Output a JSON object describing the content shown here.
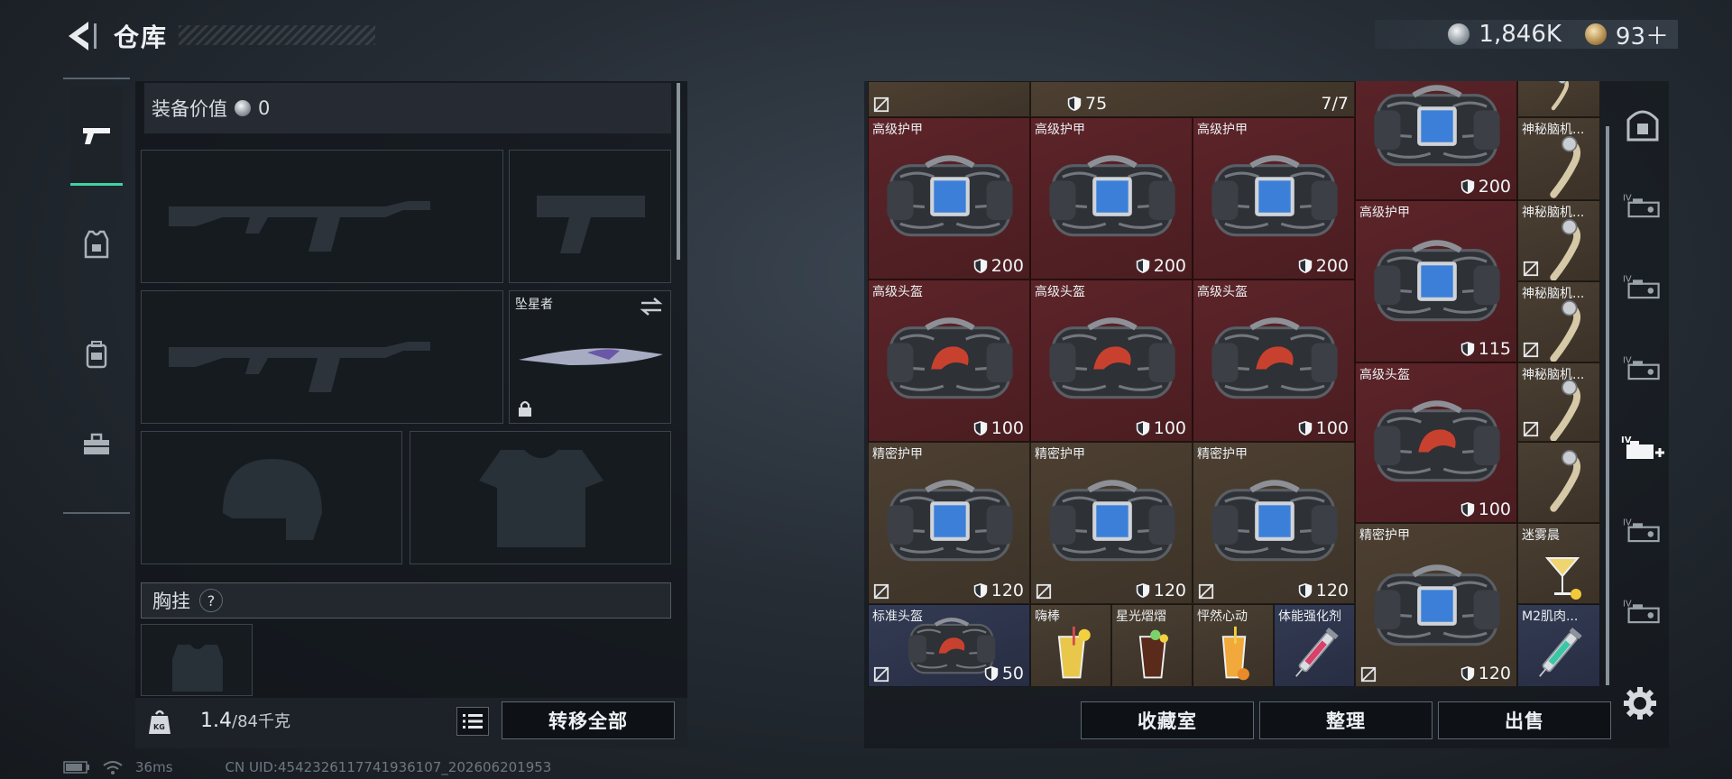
{
  "header": {
    "title": "仓库"
  },
  "currency": {
    "silver": "1,846K",
    "gold": "93＋"
  },
  "left_rail": {
    "items": [
      {
        "name": "weapons",
        "icon": "pistol-icon",
        "active": true
      },
      {
        "name": "armor",
        "icon": "armor-vest-icon",
        "active": false
      },
      {
        "name": "backpack",
        "icon": "backpack-icon",
        "active": false
      },
      {
        "name": "toolbox",
        "icon": "toolbox-icon",
        "active": false
      }
    ]
  },
  "equipment": {
    "value_label": "装备价值",
    "value": "0",
    "melee_name": "坠星者",
    "chest_rig_label": "胸挂",
    "help_mark": "?",
    "weight_current": "1.4",
    "weight_max": "/84千克",
    "transfer_all_label": "转移全部"
  },
  "storage": {
    "top_row": {
      "first_value": "75",
      "second_value": "7/7"
    },
    "cells": [
      {
        "name": "高级护甲",
        "value": "200"
      },
      {
        "name": "高级护甲",
        "value": "200"
      },
      {
        "name": "高级护甲",
        "value": "200"
      },
      {
        "name": "",
        "value": "200"
      },
      {
        "name": "神秘脑机...",
        "value": ""
      },
      {
        "name": "神秘脑机...",
        "value": ""
      },
      {
        "name": "高级护甲",
        "value": "115"
      },
      {
        "name": "高级头盔",
        "value": "100"
      },
      {
        "name": "高级头盔",
        "value": "100"
      },
      {
        "name": "高级头盔",
        "value": "100"
      },
      {
        "name": "神秘脑机...",
        "value": ""
      },
      {
        "name": "高级头盔",
        "value": "100"
      },
      {
        "name": "神秘脑机...",
        "value": ""
      },
      {
        "name": "精密护甲",
        "value": "120"
      },
      {
        "name": "精密护甲",
        "value": "120"
      },
      {
        "name": "精密护甲",
        "value": "120"
      },
      {
        "name": "迷雾晨",
        "value": ""
      },
      {
        "name": "精密护甲",
        "value": "120"
      },
      {
        "name": "标准头盔",
        "value": "50"
      },
      {
        "name": "嗨棒",
        "value": ""
      },
      {
        "name": "星光熠熠",
        "value": ""
      },
      {
        "name": "怦然心动",
        "value": ""
      },
      {
        "name": "体能强化剂",
        "value": ""
      },
      {
        "name": "M2肌肉...",
        "value": ""
      }
    ],
    "buttons": {
      "collection": "收藏室",
      "organize": "整理",
      "sell": "出售"
    }
  },
  "right_rail": {
    "items": [
      {
        "icon": "safe-box-icon"
      },
      {
        "icon": "case-iv-icon"
      },
      {
        "icon": "case-iv-icon"
      },
      {
        "icon": "case-iv-icon"
      },
      {
        "icon": "case-iv-add-icon"
      },
      {
        "icon": "case-iv-icon"
      },
      {
        "icon": "case-iv-icon"
      }
    ]
  },
  "status": {
    "ping": "36ms",
    "uid": "CN UID:4542326117741936107_202606201953"
  },
  "colors": {
    "accent": "#3fd2a4",
    "red_rarity": "#5c2429",
    "gold_rarity": "#4d4032",
    "blue_rarity": "#333b54"
  }
}
